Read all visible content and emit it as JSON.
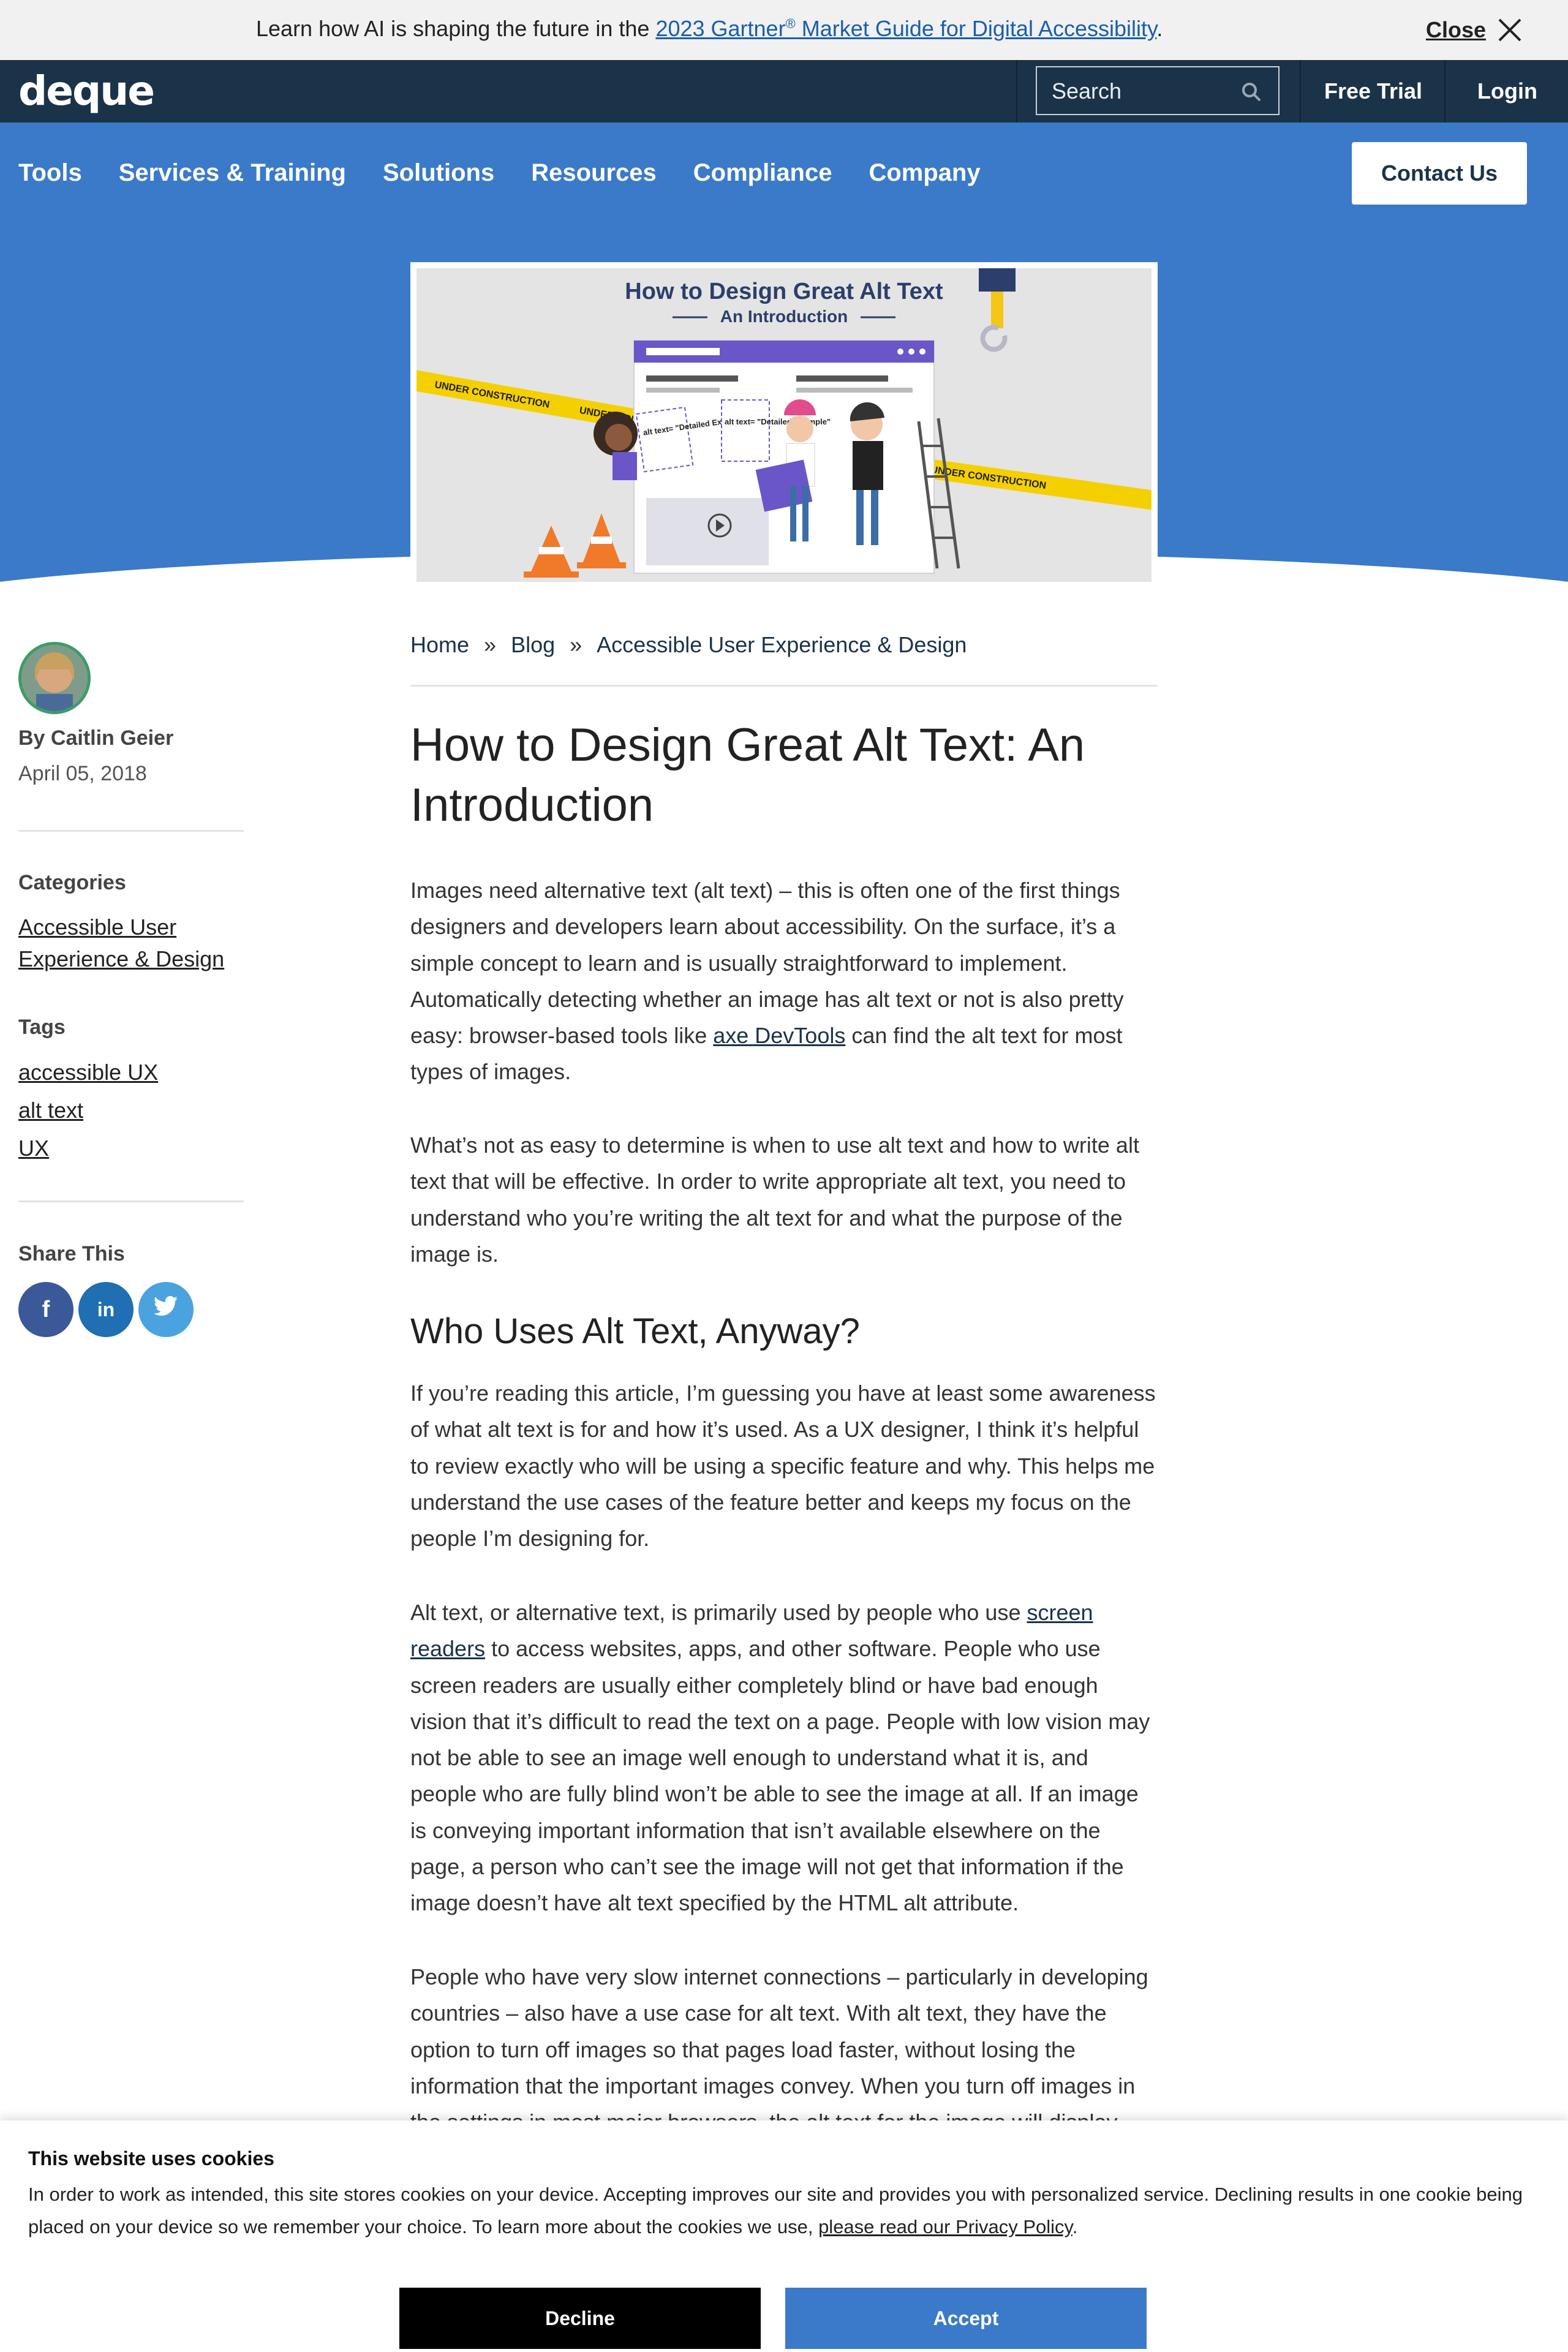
{
  "announcement": {
    "prefix": "Learn how AI is shaping the future in the ",
    "link_text": "2023 Gartner",
    "link_sup": "®",
    "link_suffix": " Market Guide for Digital Accessibility",
    "end": ".",
    "close_label": "Close"
  },
  "topbar": {
    "logo": "deque",
    "search_placeholder": "Search",
    "free_trial": "Free Trial",
    "login": "Login"
  },
  "nav": {
    "items": [
      "Tools",
      "Services & Training",
      "Solutions",
      "Resources",
      "Compliance",
      "Company"
    ],
    "contact": "Contact Us"
  },
  "featured_image": {
    "title": "How to Design Great Alt Text",
    "subtitle": "An Introduction",
    "tape_text": "UNDER CONSTRUCTION",
    "sign1": "alt text= \"Detailed Example\"",
    "sign2": "alt text= \"Detailed Example\""
  },
  "sidebar": {
    "author": "By Caitlin Geier",
    "date": "April 05, 2018",
    "categories_heading": "Categories",
    "category_line1": "Accessible User",
    "category_line2": "Experience & Design",
    "tags_heading": "Tags",
    "tags": [
      "accessible UX",
      "alt text",
      "UX"
    ],
    "share_heading": "Share This",
    "share": {
      "facebook": "f",
      "linkedin": "in"
    }
  },
  "breadcrumb": {
    "home": "Home",
    "blog": "Blog",
    "category": "Accessible User Experience & Design",
    "sep": "»"
  },
  "article": {
    "title": "How to Design Great Alt Text: An Introduction",
    "p1_a": "Images need alternative text (alt text) – this is often one of the first things designers and developers learn about accessibility. On the surface, it’s a simple concept to learn and is usually straightforward to implement. Automatically detecting whether an image has alt text or not is also pretty easy: browser-based tools like ",
    "p1_link": "axe DevTools",
    "p1_b": " can find the alt text for most types of images.",
    "p2": "What’s not as easy to determine is when to use alt text and how to write alt text that will be effective. In order to write appropriate alt text, you need to understand who you’re writing the alt text for and what the purpose of the image is.",
    "h2": "Who Uses Alt Text, Anyway?",
    "p3": "If you’re reading this article, I’m guessing you have at least some awareness of what alt text is for and how it’s used. As a UX designer, I think it’s helpful to review exactly who will be using a specific feature and why. This helps me understand the use cases of the feature better and keeps my focus on the people I’m designing for.",
    "p4_a": "Alt text, or alternative text, is primarily used by people who use ",
    "p4_link": "screen readers",
    "p4_b": " to access websites, apps, and other software. People who use screen readers are usually either completely blind or have bad enough vision that it’s difficult to read the text on a page. People with low vision may not be able to see an image well enough to understand what it is, and people who are fully blind won’t be able to see the image at all. If an image is conveying important information that isn’t available elsewhere on the page, a person who can’t see the image will not get that information if the image doesn’t have alt text specified by the HTML alt attribute.",
    "p5": "People who have very slow internet connections – particularly in developing countries – also have a use case for alt text. With alt text, they have the option to turn off images so that pages load faster, without losing the information that the important images convey. When you turn off images in the settings in most major browsers, the alt text for the image will display"
  },
  "cookie": {
    "title": "This website uses cookies",
    "text": "In order to work as intended, this site stores cookies on your device. Accepting improves our site and provides you with personalized service. Declining results in one cookie being placed on your device so we remember your choice. To learn more about the cookies we use, ",
    "link": "please read our Privacy Policy",
    "end": ".",
    "decline": "Decline",
    "accept": "Accept"
  },
  "colors": {
    "brand_dark": "#1b3348",
    "brand_blue": "#3a7ac8",
    "facebook": "#3b5998",
    "linkedin": "#1f6fb2",
    "twitter": "#4aa3df"
  }
}
